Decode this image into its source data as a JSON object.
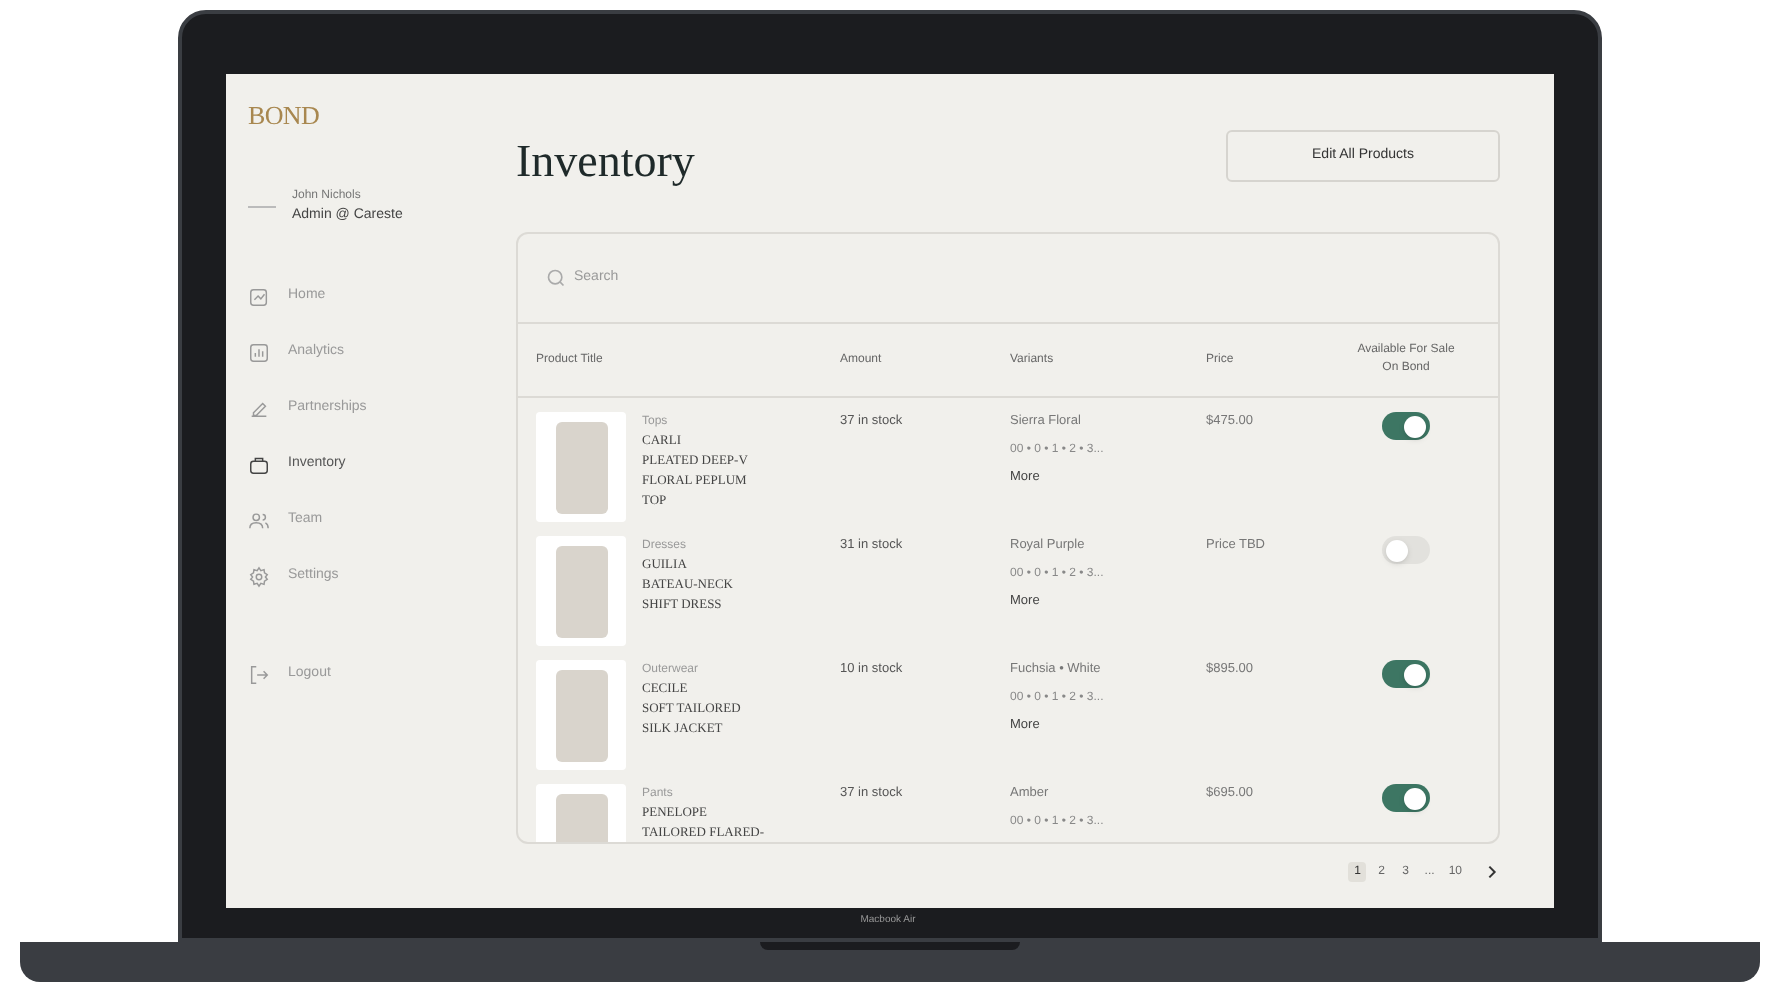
{
  "brand": "BOND",
  "user": {
    "name": "John Nichols",
    "role": "Admin @ Careste"
  },
  "nav": [
    {
      "label": "Home",
      "kind": "home",
      "selected": false
    },
    {
      "label": "Analytics",
      "kind": "analytics",
      "selected": false
    },
    {
      "label": "Partnerships",
      "kind": "partnerships",
      "selected": false
    },
    {
      "label": "Inventory",
      "kind": "inventory",
      "selected": true
    },
    {
      "label": "Team",
      "kind": "team",
      "selected": false
    },
    {
      "label": "Settings",
      "kind": "settings",
      "selected": false
    }
  ],
  "logout": "Logout",
  "page_title": "Inventory",
  "edit_button": "Edit All Products",
  "search": {
    "placeholder": "Search"
  },
  "table": {
    "columns": [
      "Product Title",
      "Amount",
      "Variants",
      "Price",
      "Available For Sale On Bond"
    ],
    "rows": [
      {
        "category": "Tops",
        "title_lines": [
          "CARLI",
          "PLEATED DEEP-V",
          "FLORAL PEPLUM",
          "TOP"
        ],
        "amount": "37 in stock",
        "variant": "Sierra Floral",
        "sizes": "00 • 0 • 1 • 2 • 3...",
        "more": "More",
        "price": "$475.00",
        "on": true
      },
      {
        "category": "Dresses",
        "title_lines": [
          "GUILIA",
          "BATEAU-NECK",
          "SHIFT DRESS"
        ],
        "amount": "31 in stock",
        "variant": "Royal Purple",
        "sizes": "00 • 0 • 1 • 2 • 3...",
        "more": "More",
        "price": "Price TBD",
        "on": false
      },
      {
        "category": "Outerwear",
        "title_lines": [
          "CECILE",
          "SOFT TAILORED",
          "SILK JACKET"
        ],
        "amount": "10 in stock",
        "variant": "Fuchsia • White",
        "sizes": "00 • 0 • 1 • 2 • 3...",
        "more": "More",
        "price": "$895.00",
        "on": true
      },
      {
        "category": "Pants",
        "title_lines": [
          "PENELOPE",
          "TAILORED FLARED-"
        ],
        "amount": "37 in stock",
        "variant": "Amber",
        "sizes": "00 • 0 • 1 • 2 • 3...",
        "price": "$695.00",
        "on": true
      }
    ]
  },
  "pagination": [
    {
      "label": "1",
      "selected": true
    },
    {
      "label": "2",
      "selected": false
    },
    {
      "label": "3",
      "selected": false
    },
    {
      "label": "...",
      "selected": false
    },
    {
      "label": "10",
      "selected": false
    }
  ],
  "device_label": "Macbook Air"
}
